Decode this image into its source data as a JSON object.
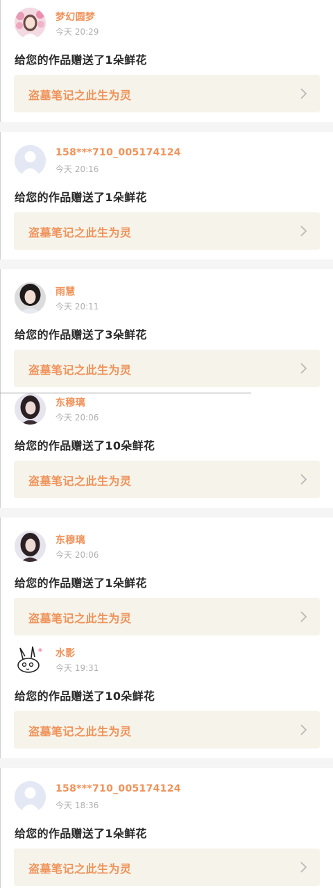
{
  "notifications": [
    {
      "user": "梦幻圆梦",
      "time": "今天 20:29",
      "message": "给您的作品赠送了1朵鲜花",
      "work_title": "盗墓笔记之此生为灵",
      "avatar_icon": "girl-flowers-avatar-icon"
    },
    {
      "user": "158***710_005174124",
      "time": "今天 20:16",
      "message": "给您的作品赠送了1朵鲜花",
      "work_title": "盗墓笔记之此生为灵",
      "avatar_icon": "default-user-avatar-icon"
    },
    {
      "user": "雨慧",
      "time": "今天 20:11",
      "message": "给您的作品赠送了3朵鲜花",
      "work_title": "盗墓笔记之此生为灵",
      "avatar_icon": "girl-portrait-avatar-icon"
    },
    {
      "user": "东穆璃",
      "time": "今天 20:06",
      "message": "给您的作品赠送了10朵鲜花",
      "work_title": "盗墓笔记之此生为灵",
      "avatar_icon": "girl-dark-hair-avatar-icon"
    },
    {
      "user": "东穆璃",
      "time": "今天 20:06",
      "message": "给您的作品赠送了1朵鲜花",
      "work_title": "盗墓笔记之此生为灵",
      "avatar_icon": "girl-dark-hair-avatar-icon"
    },
    {
      "user": "水影",
      "time": "今天 19:31",
      "message": "给您的作品赠送了10朵鲜花",
      "work_title": "盗墓笔记之此生为灵",
      "avatar_icon": "rabbit-doodle-avatar-icon"
    },
    {
      "user": "158***710_005174124",
      "time": "今天 18:36",
      "message": "给您的作品赠送了1朵鲜花",
      "work_title": "盗墓笔记之此生为灵",
      "avatar_icon": "default-user-avatar-icon"
    }
  ],
  "colors": {
    "accent": "#f0925a",
    "card_background": "#f6f4ea",
    "divider": "#f5f5f5",
    "message_text": "#2a2a2a",
    "time_text": "#b0b0b0"
  }
}
